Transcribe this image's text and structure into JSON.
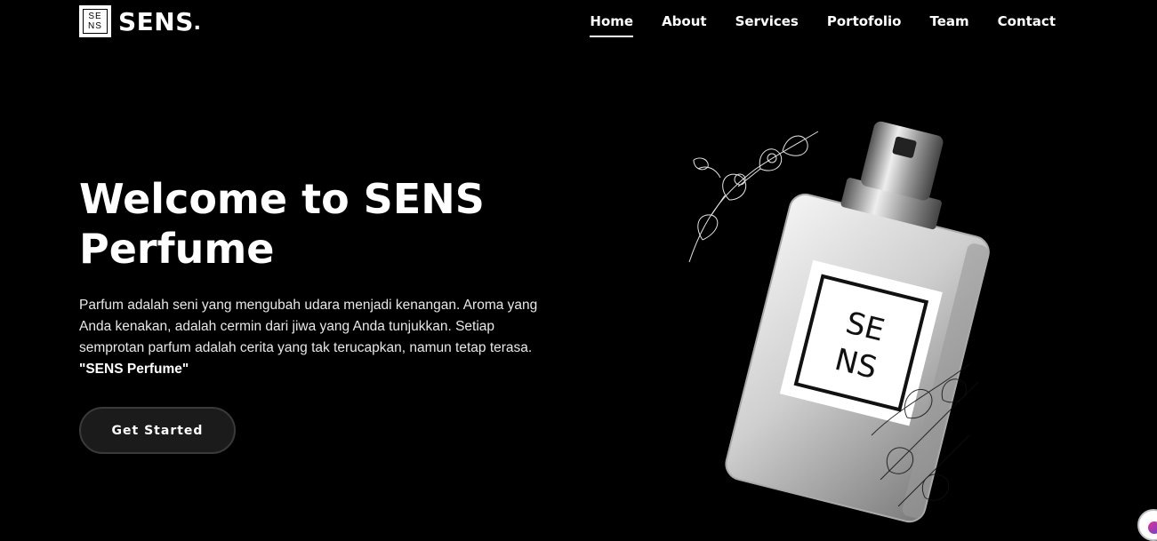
{
  "brand": {
    "logo_top": "SE",
    "logo_bottom": "NS",
    "name": "SENS",
    "dot": "."
  },
  "nav": {
    "items": [
      {
        "label": "Home",
        "active": true
      },
      {
        "label": "About",
        "active": false
      },
      {
        "label": "Services",
        "active": false
      },
      {
        "label": "Portofolio",
        "active": false
      },
      {
        "label": "Team",
        "active": false
      },
      {
        "label": "Contact",
        "active": false
      }
    ]
  },
  "hero": {
    "title": "Welcome to SENS Perfume",
    "description": "Parfum adalah seni yang mengubah udara menjadi kenangan. Aroma yang Anda kenakan, adalah cermin dari jiwa yang Anda tunjukkan. Setiap semprotan parfum adalah cerita yang tak terucapkan, namun tetap terasa.",
    "quote": "\"SENS Perfume\"",
    "cta_label": "Get Started"
  },
  "product": {
    "label_top": "SE",
    "label_bottom": "NS"
  },
  "colors": {
    "background": "#000000",
    "text": "#ffffff",
    "button_bg": "#1b1b1b"
  }
}
